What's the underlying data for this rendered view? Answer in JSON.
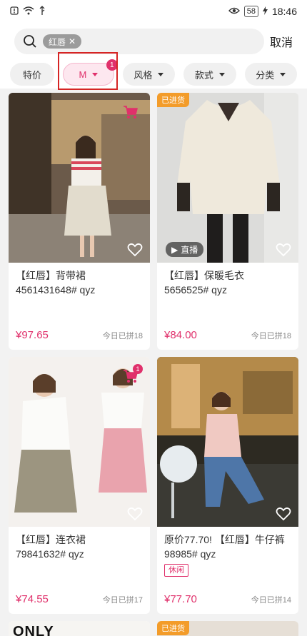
{
  "status_bar": {
    "time": "18:46",
    "battery": "58",
    "icons": [
      "alert-icon",
      "wifi-icon",
      "usb-icon",
      "eye-icon",
      "charging-icon"
    ]
  },
  "header": {
    "search_chip": "红唇",
    "cancel_label": "取消"
  },
  "filters": [
    {
      "label": "特价"
    },
    {
      "label": "M",
      "badge": "1",
      "active": true
    },
    {
      "label": "风格"
    },
    {
      "label": "款式"
    },
    {
      "label": "分类"
    }
  ],
  "products": [
    {
      "title_line1": "【红唇】背带裙",
      "title_line2": "4561431648# qyz",
      "price": "¥97.65",
      "sold": "今日已拼18",
      "cart_count": "1"
    },
    {
      "tag": "已进货",
      "live_label": "直播",
      "title_line1": "【红唇】保暖毛衣",
      "title_line2": "5656525# qyz",
      "price": "¥84.00",
      "sold": "今日已拼18"
    },
    {
      "title_line1": "【红唇】连衣裙",
      "title_line2": "79841632# qyz",
      "price": "¥74.55",
      "sold": "今日已拼17",
      "cart_count": "1"
    },
    {
      "title_line1": "原价77.70! 【红唇】牛仔裤",
      "title_line2": "98985# qyz",
      "style_tag": "休闲",
      "price": "¥77.70",
      "sold": "今日已拼14"
    },
    {
      "brand_logo": "ONLY"
    },
    {
      "tag": "已进货"
    }
  ],
  "colors": {
    "accent": "#e0306b",
    "tag_orange": "#f39c2a",
    "highlight_red": "#d62424"
  }
}
